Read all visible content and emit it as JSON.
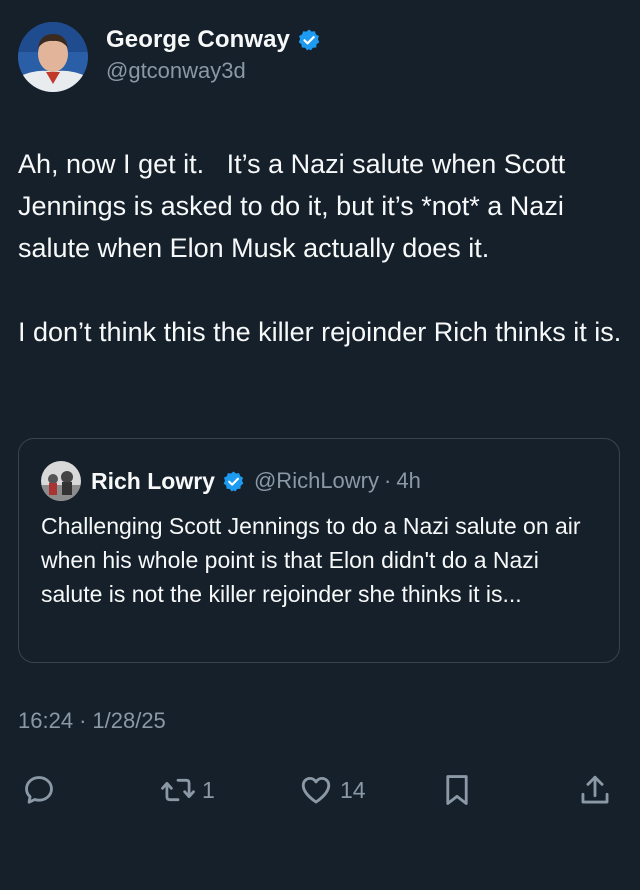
{
  "author": {
    "display_name": "George Conway",
    "handle": "@gtconway3d",
    "verified": true
  },
  "tweet": {
    "paragraphs": [
      "Ah, now I get it.   It’s a Nazi salute when Scott Jennings is asked to do it, but it’s *not* a Nazi salute when Elon Musk actually does it.",
      "I don’t think this the killer rejoinder Rich thinks it is."
    ]
  },
  "quote": {
    "display_name": "Rich Lowry",
    "handle": "@RichLowry",
    "separator": "·",
    "time": "4h",
    "verified": true,
    "text": "Challenging Scott Jennings to do a Nazi salute on air when his whole point is that Elon didn't do a Nazi salute is not  the killer rejoinder she thinks it is..."
  },
  "meta": {
    "time": "16:24",
    "separator": "·",
    "date": "1/28/25"
  },
  "actions": {
    "reply": {
      "icon": "reply-icon",
      "count": ""
    },
    "retweet": {
      "icon": "retweet-icon",
      "count": "1"
    },
    "like": {
      "icon": "heart-icon",
      "count": "14"
    },
    "bookmark": {
      "icon": "bookmark-icon",
      "count": ""
    },
    "share": {
      "icon": "share-icon",
      "count": ""
    }
  },
  "colors": {
    "background": "#15202b",
    "text": "#f7f9f9",
    "muted": "#8b98a5",
    "border": "#38444d",
    "verified_blue": "#1d9bf0"
  }
}
